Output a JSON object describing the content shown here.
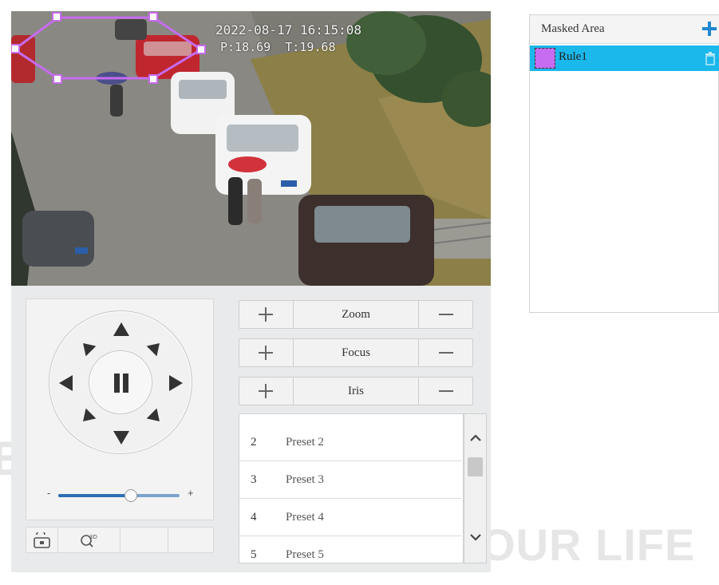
{
  "video": {
    "timestamp": "2022-08-17 16:15:08",
    "coordinates": "P:18.69  T:19.68"
  },
  "ptz": {
    "speed_min_label": "-",
    "speed_max_label": "+",
    "speed_fraction": 0.6
  },
  "lens": {
    "zoom_label": "Zoom",
    "focus_label": "Focus",
    "iris_label": "Iris"
  },
  "presets": [
    {
      "num": "2",
      "name": "Preset 2"
    },
    {
      "num": "3",
      "name": "Preset 3"
    },
    {
      "num": "4",
      "name": "Preset 4"
    },
    {
      "num": "5",
      "name": "Preset 5"
    }
  ],
  "mask": {
    "title": "Masked Area",
    "rules": [
      {
        "name": "Rule1",
        "color": "#c66cf0"
      }
    ],
    "selected_row_color": "#1bb8ec"
  },
  "watermark": {
    "tagline": "WE SECURE YOUR LIFE",
    "fragment": "EST."
  }
}
